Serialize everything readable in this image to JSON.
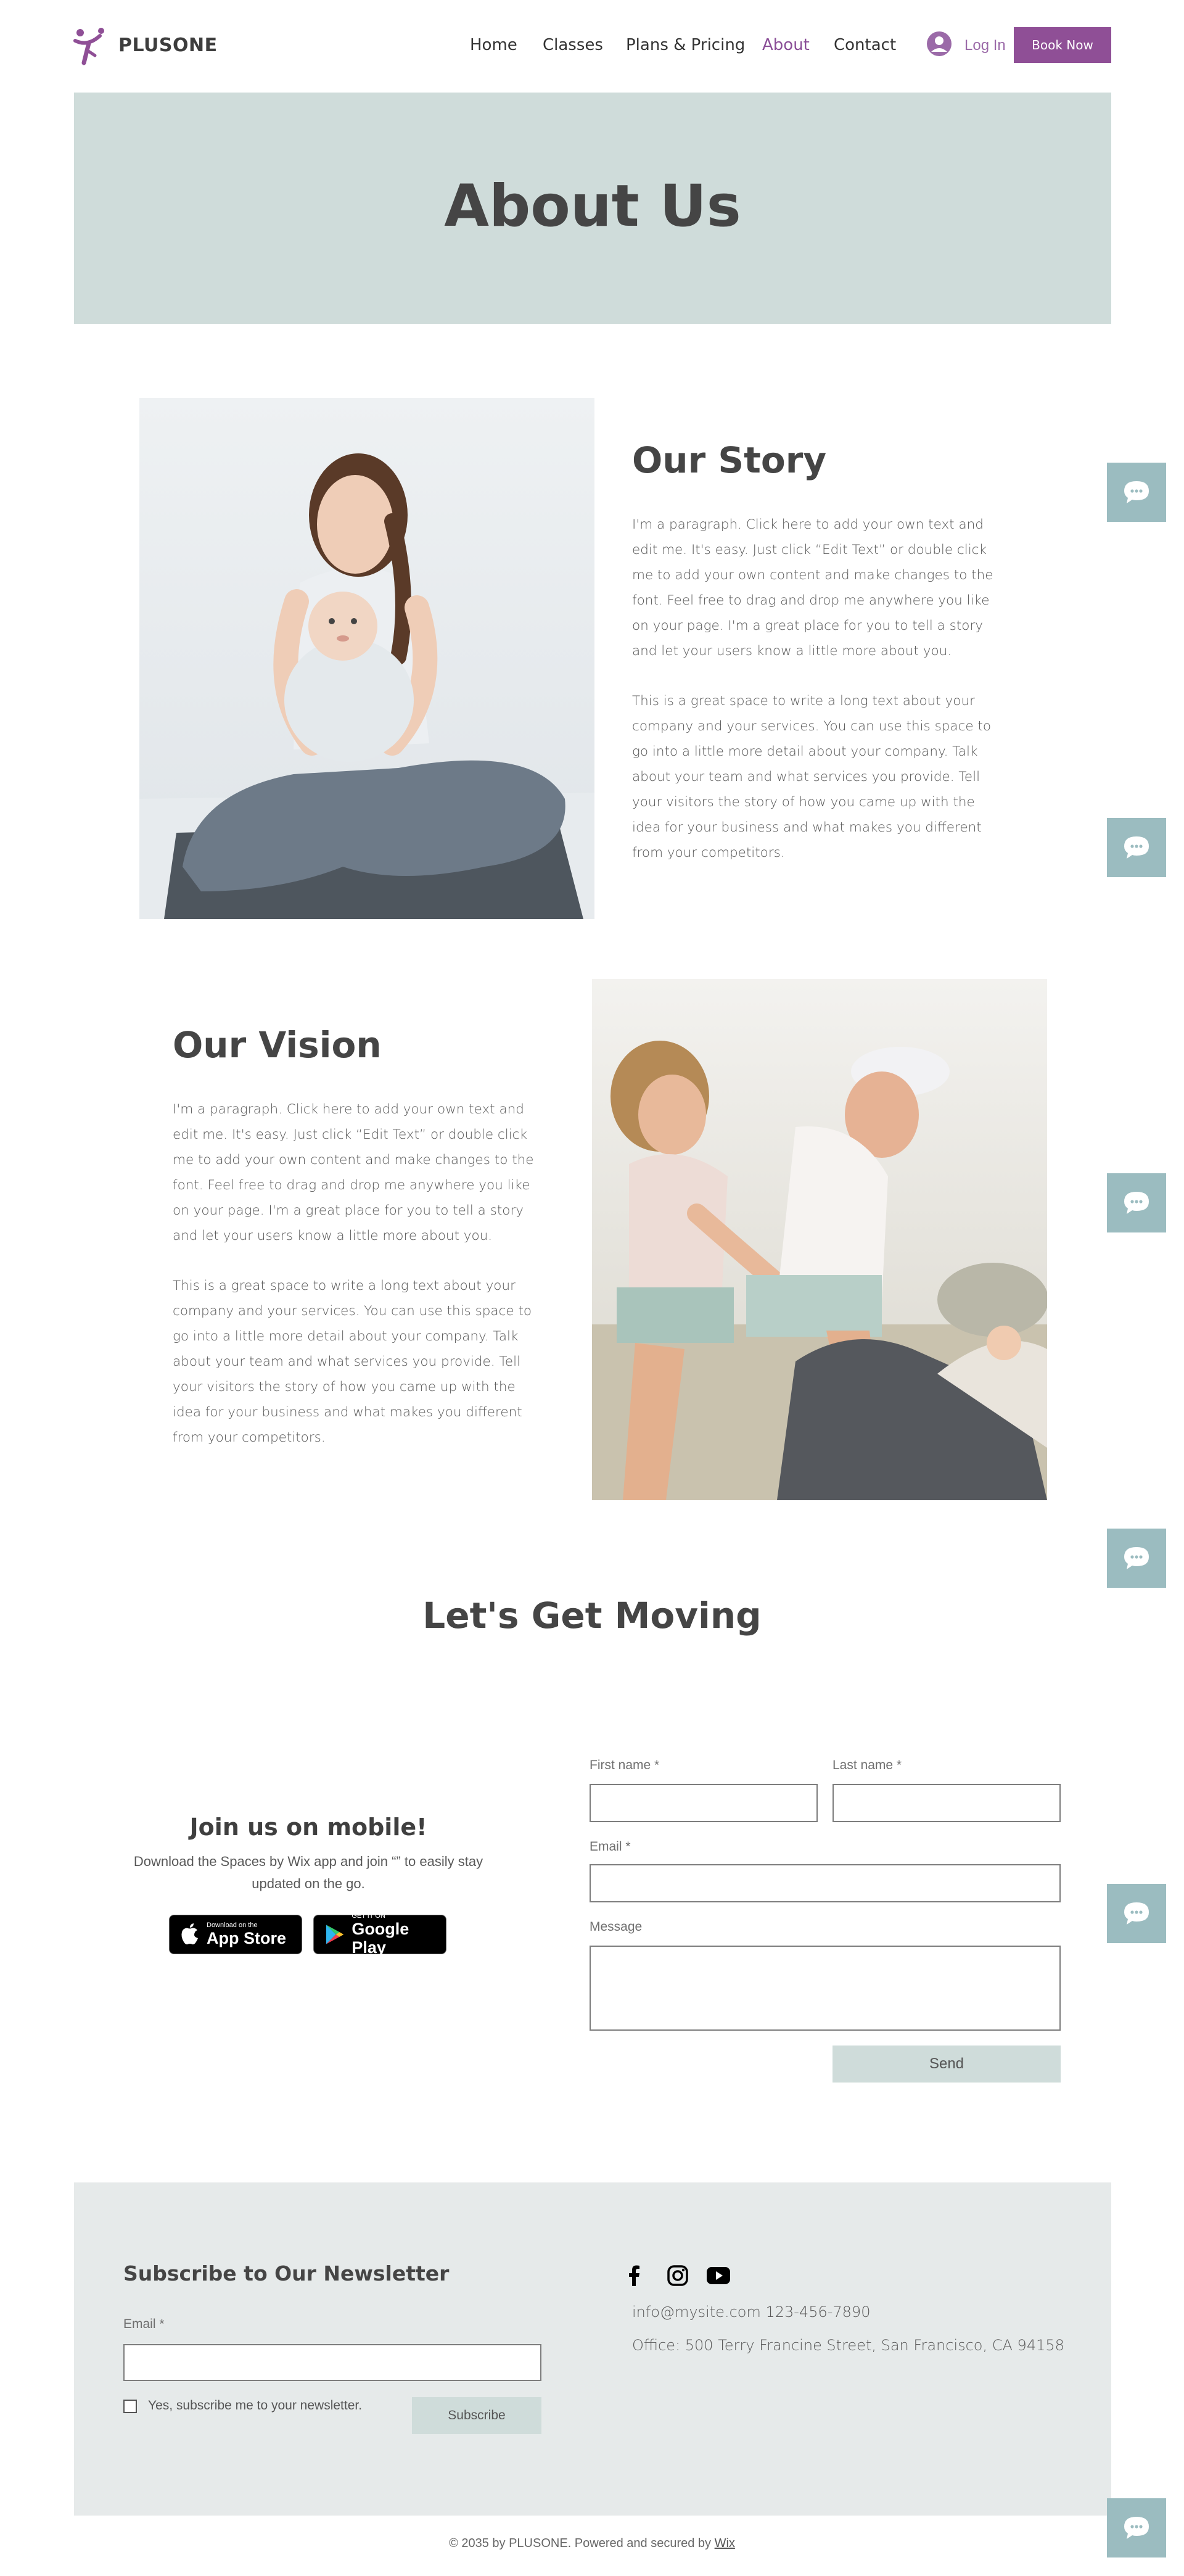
{
  "header": {
    "brand": "PLUSONE",
    "nav": [
      "Home",
      "Classes",
      "Plans & Pricing",
      "About",
      "Contact"
    ],
    "active_nav": "About",
    "login_label": "Log In",
    "book_label": "Book Now"
  },
  "hero": {
    "title": "About Us"
  },
  "story": {
    "title": "Our Story",
    "paragraphs": [
      [
        "I'm a paragraph. Click here to add your own text and",
        "edit me. It's easy. Just click “Edit Text” or double click",
        "me to add your own content and make changes to the",
        "font. Feel free to drag and drop me anywhere you like",
        "on your page. I'm a great place for you to tell a story",
        "and let your users know a little more about you."
      ],
      [
        "This is a great space to write a long text about your",
        "company and your services. You can use this space to",
        "go into a little more detail about your company. Talk",
        "about your team and what services you provide. Tell",
        "your visitors the story of how you came up with the",
        "idea for your business and what makes you different",
        "from your competitors."
      ]
    ]
  },
  "vision": {
    "title": "Our Vision",
    "paragraphs": [
      [
        "I'm a paragraph. Click here to add your own text and",
        "edit me. It's easy. Just click “Edit Text” or double click",
        "me to add your own content and make changes to the",
        "font. Feel free to drag and drop me anywhere you like",
        "on your page. I'm a great place for you to tell a story",
        "and let your users know a little more about you."
      ],
      [
        "This is a great space to write a long text about your",
        "company and your services. You can use this space to",
        "go into a little more detail about your company. Talk",
        "about your team and what services you provide. Tell",
        "your visitors the story of how you came up with the",
        "idea for your business and what makes you different",
        "from your competitors."
      ]
    ]
  },
  "moving": {
    "title": "Let's Get Moving"
  },
  "mobile": {
    "title": "Join us on mobile!",
    "text_lines": [
      "Download the Spaces by Wix app and join “” to easily stay",
      "updated on the go."
    ],
    "app_store_small": "Download on the",
    "app_store_big": "App Store",
    "google_small": "GET IT ON",
    "google_big": "Google Play"
  },
  "contact_form": {
    "first_name_label": "First name *",
    "last_name_label": "Last name *",
    "email_label": "Email *",
    "message_label": "Message",
    "send_label": "Send"
  },
  "footer": {
    "newsletter_title": "Subscribe to Our Newsletter",
    "email_label": "Email *",
    "checkbox_label": "Yes, subscribe me to your newsletter.",
    "subscribe_label": "Subscribe",
    "email_phone": "info@mysite.com  123-456-7890",
    "address": "Office: 500 Terry Francine Street, San Francisco, CA 94158",
    "copyright": "© 2035 by PLUSONE. Powered and secured by",
    "copyright_link": "Wix"
  },
  "colors": {
    "accent": "#8f4f96",
    "hero_bg": "#cfdcda",
    "footer_bg": "#e6eaea",
    "chat_bg": "#9bbcc0"
  },
  "icons": [
    "logo-figure-icon",
    "user-avatar-icon",
    "apple-icon",
    "google-play-icon",
    "facebook-icon",
    "instagram-icon",
    "youtube-icon",
    "chat-bubble-icon"
  ]
}
